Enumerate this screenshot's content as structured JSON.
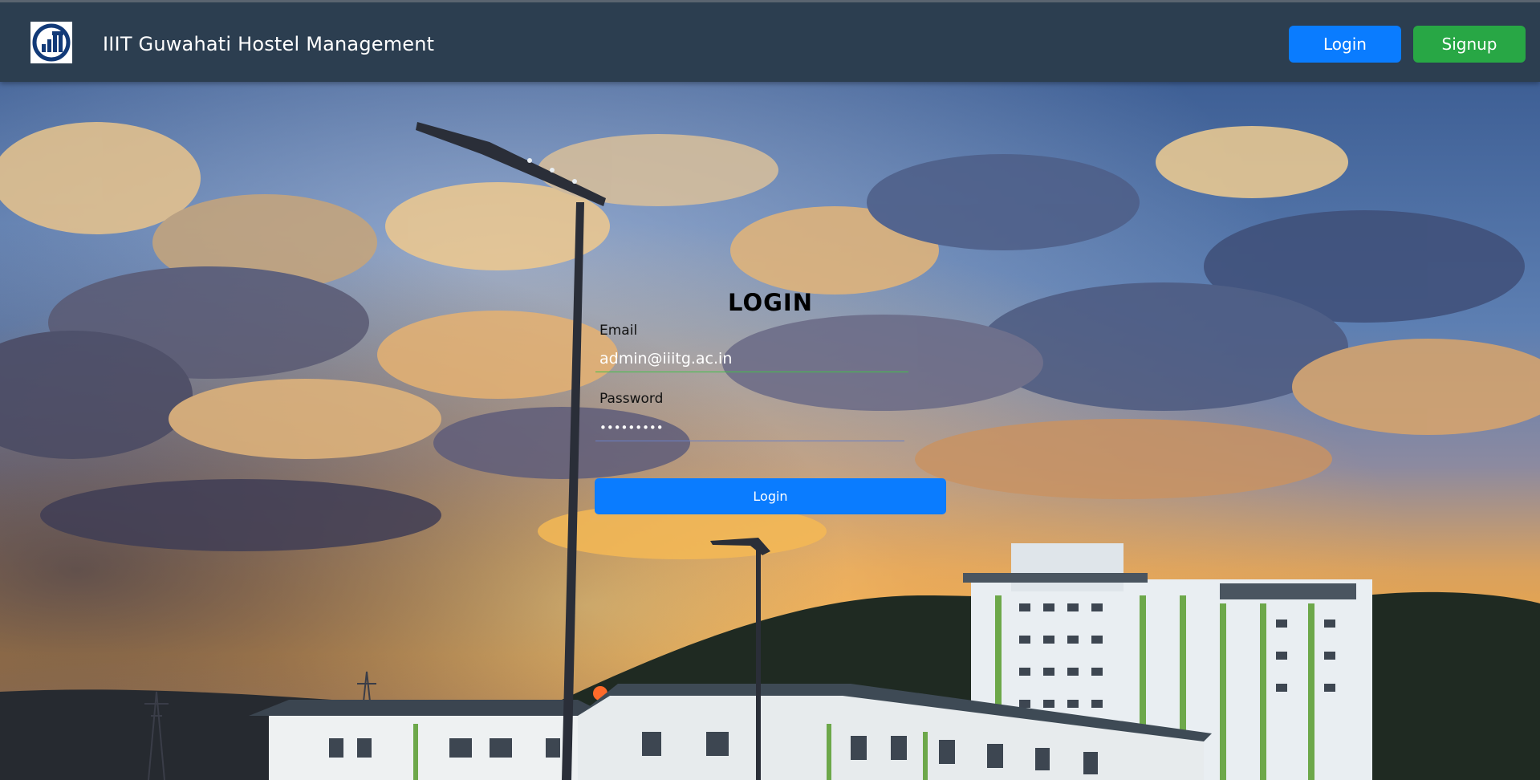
{
  "navbar": {
    "brand_title": "IIIT Guwahati Hostel Management",
    "logo_icon": "iiitg-logo-icon",
    "login_label": "Login",
    "signup_label": "Signup",
    "login_color": "#0a7cff",
    "signup_color": "#28a745",
    "background_color": "#2c3e50"
  },
  "login_form": {
    "title": "LOGIN",
    "email_label": "Email",
    "email_value": "admin@iiitg.ac.in",
    "password_label": "Password",
    "password_value": "•••••••••",
    "submit_label": "Login",
    "submit_color": "#0a7cff"
  },
  "background": {
    "scene": "campus-sunset-photo"
  }
}
